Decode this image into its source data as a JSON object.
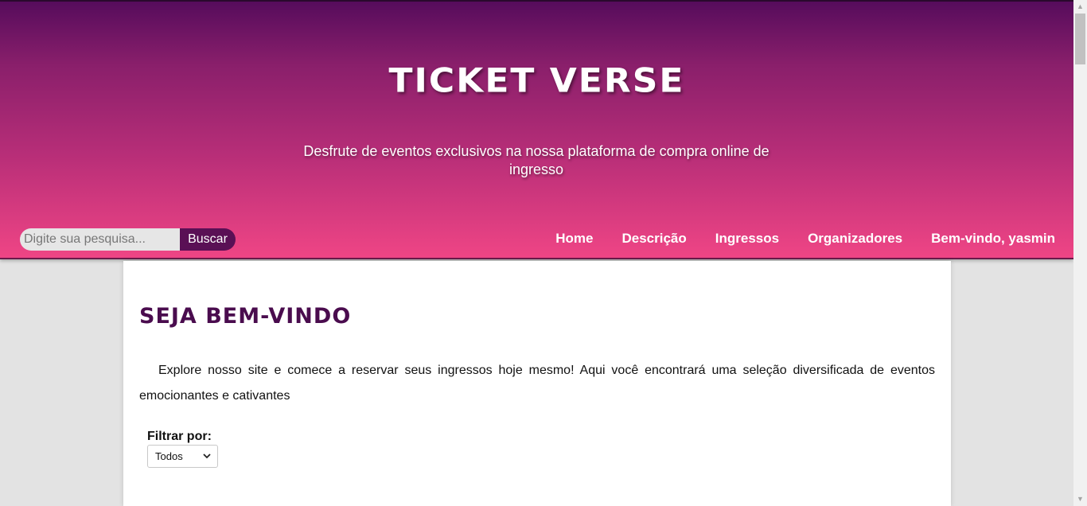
{
  "header": {
    "title": "TICKET VERSE",
    "tagline": "Desfrute de eventos exclusivos na nossa plataforma de compra online de ingresso"
  },
  "search": {
    "placeholder": "Digite sua pesquisa...",
    "button_label": "Buscar"
  },
  "nav": {
    "items": [
      {
        "label": "Home"
      },
      {
        "label": "Descrição"
      },
      {
        "label": "Ingressos"
      },
      {
        "label": "Organizadores"
      },
      {
        "label": "Bem-vindo, yasmin"
      }
    ]
  },
  "main": {
    "heading": "SEJA BEM-VINDO",
    "intro": "Explore nosso site e comece a reservar seus ingressos hoje mesmo! Aqui você encontrará uma seleção diversificada de eventos emocionantes e cativantes",
    "filter": {
      "label": "Filtrar por:",
      "selected": "Todos"
    }
  },
  "colors": {
    "header_gradient_top": "#560c5c",
    "header_gradient_bottom": "#ef4585",
    "accent_dark": "#5a1055",
    "heading": "#4a0c4e"
  },
  "icons": {
    "select_arrow": "chevron-down-icon"
  }
}
